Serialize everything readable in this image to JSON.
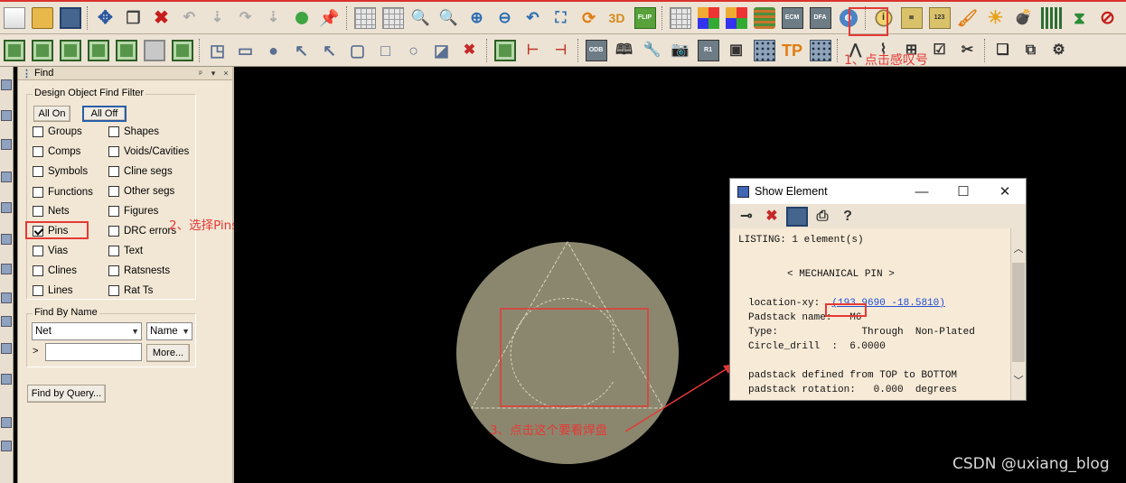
{
  "toolbar_top": {
    "icons": [
      {
        "name": "new-file-icon",
        "kind": "file",
        "text": ""
      },
      {
        "name": "open-folder-icon",
        "kind": "open",
        "text": ""
      },
      {
        "name": "save-icon",
        "kind": "save",
        "text": ""
      },
      {
        "sep": true
      },
      {
        "name": "move-icon",
        "kind": "move",
        "text": "✥"
      },
      {
        "name": "copy-icon",
        "kind": "copy",
        "text": "❐"
      },
      {
        "name": "delete-icon",
        "kind": "del",
        "text": "✖"
      },
      {
        "name": "undo-icon",
        "kind": "gray",
        "text": "↶"
      },
      {
        "name": "step-down-icon",
        "kind": "gray",
        "text": "⇣"
      },
      {
        "name": "redo-icon",
        "kind": "gray",
        "text": "↷"
      },
      {
        "name": "step-down-2-icon",
        "kind": "gray",
        "text": "⇣"
      },
      {
        "name": "shape-edit-icon",
        "kind": "green",
        "text": ""
      },
      {
        "name": "pin-icon",
        "kind": "pin",
        "text": "📌"
      },
      {
        "sep": true
      },
      {
        "name": "grid-toggle-icon",
        "kind": "grid",
        "text": ""
      },
      {
        "name": "grid-points-icon",
        "kind": "grid",
        "text": ""
      },
      {
        "name": "zoom-fit-icon",
        "kind": "zoom",
        "text": "🔍"
      },
      {
        "name": "zoom-point-icon",
        "kind": "zoom",
        "text": "🔍"
      },
      {
        "name": "zoom-in-icon",
        "kind": "zoom",
        "text": "⊕"
      },
      {
        "name": "zoom-out-icon",
        "kind": "zoom",
        "text": "⊖"
      },
      {
        "name": "zoom-previous-icon",
        "kind": "zoom",
        "text": "↶"
      },
      {
        "name": "zoom-world-icon",
        "kind": "zoom",
        "text": "⛶"
      },
      {
        "name": "redraw-icon",
        "kind": "orange",
        "text": "⟳"
      },
      {
        "name": "3d-view-icon",
        "kind": "3d",
        "text": "3D"
      },
      {
        "name": "flip-icon",
        "kind": "flip",
        "text": "FLIP"
      },
      {
        "sep": true
      },
      {
        "name": "grid-setup-icon",
        "kind": "grid",
        "text": ""
      },
      {
        "name": "color-icon",
        "kind": "color",
        "text": ""
      },
      {
        "name": "layer-visibility-icon",
        "kind": "color",
        "text": ""
      },
      {
        "name": "layer-stack-icon",
        "kind": "stack",
        "text": ""
      },
      {
        "name": "ecm-icon",
        "kind": "chip",
        "text": "ECM"
      },
      {
        "name": "dfa-icon",
        "kind": "chip",
        "text": "DFA"
      },
      {
        "name": "globe-icon",
        "kind": "globe",
        "text": "◍"
      },
      {
        "sep": true
      },
      {
        "name": "show-element-info-icon",
        "kind": "info",
        "text": "i"
      },
      {
        "name": "show-measure-icon",
        "kind": "ruler",
        "text": "≣"
      },
      {
        "name": "measure-icon",
        "kind": "ruler",
        "text": "123"
      },
      {
        "name": "brush-icon",
        "kind": "orange",
        "text": "🖌"
      },
      {
        "name": "highlight-icon",
        "kind": "sun",
        "text": "☀"
      },
      {
        "name": "bomb-icon",
        "kind": "tool",
        "text": "💣"
      },
      {
        "name": "bar-chart-icon",
        "kind": "bars",
        "text": ""
      },
      {
        "name": "hourglass-icon",
        "kind": "hour",
        "text": "⧗"
      },
      {
        "name": "no-entry-icon",
        "kind": "del",
        "text": "⊘"
      }
    ]
  },
  "toolbar_second": {
    "icons": [
      {
        "name": "cmd-1-icon",
        "kind": "box",
        "text": ""
      },
      {
        "name": "cmd-2-icon",
        "kind": "box",
        "text": ""
      },
      {
        "name": "cmd-3-icon",
        "kind": "box",
        "text": ""
      },
      {
        "name": "cmd-4-icon",
        "kind": "box",
        "text": ""
      },
      {
        "name": "cmd-5-icon",
        "kind": "box",
        "text": ""
      },
      {
        "name": "cmd-6-icon",
        "kind": "boxg",
        "text": ""
      },
      {
        "name": "cmd-7-icon",
        "kind": "box",
        "text": ""
      },
      {
        "sep": true
      },
      {
        "name": "add-corner-icon",
        "kind": "shape",
        "text": "◳"
      },
      {
        "name": "add-rect-icon",
        "kind": "shape",
        "text": "▭"
      },
      {
        "name": "add-circle-icon",
        "kind": "shape",
        "text": "●"
      },
      {
        "name": "select-icon",
        "kind": "shape",
        "text": "↖"
      },
      {
        "name": "select-2-icon",
        "kind": "shape",
        "text": "↖"
      },
      {
        "name": "rounded-rect-icon",
        "kind": "shape",
        "text": "▢"
      },
      {
        "name": "square-icon",
        "kind": "shape",
        "text": "□"
      },
      {
        "name": "circle-outline-icon",
        "kind": "shape",
        "text": "○"
      },
      {
        "name": "shape-3-icon",
        "kind": "shape",
        "text": "◪"
      },
      {
        "name": "delete-shape-icon",
        "kind": "x",
        "text": "✖"
      },
      {
        "sep": true
      },
      {
        "name": "component-icon",
        "kind": "box",
        "text": ""
      },
      {
        "name": "dimension-icon",
        "kind": "dim",
        "text": "⊢"
      },
      {
        "name": "dimension-2-icon",
        "kind": "dim",
        "text": "⊣"
      },
      {
        "sep": true
      },
      {
        "name": "odb-icon",
        "kind": "chip",
        "text": "ODB"
      },
      {
        "name": "book-icon",
        "kind": "tool",
        "text": "🕮"
      },
      {
        "name": "wrench-icon",
        "kind": "tool",
        "text": "🔧"
      },
      {
        "name": "camera-icon",
        "kind": "tool",
        "text": "📷"
      },
      {
        "name": "refdes-icon",
        "kind": "chip",
        "text": "R1"
      },
      {
        "name": "drill-icon",
        "kind": "tool",
        "text": "▣"
      },
      {
        "name": "matrix-icon",
        "kind": "mat",
        "text": ""
      },
      {
        "name": "testpoint-icon",
        "kind": "orange",
        "text": "TP"
      },
      {
        "name": "via-array-icon",
        "kind": "mat",
        "text": ""
      },
      {
        "sep": true
      },
      {
        "name": "route-icon",
        "kind": "tool",
        "text": "⋀"
      },
      {
        "name": "slide-icon",
        "kind": "tool",
        "text": "⌇"
      },
      {
        "name": "spread-icon",
        "kind": "tool",
        "text": "⊞"
      },
      {
        "name": "check-icon",
        "kind": "tool",
        "text": "☑"
      },
      {
        "name": "cut-icon",
        "kind": "tool",
        "text": "✂"
      },
      {
        "sep": true
      },
      {
        "name": "window-icon",
        "kind": "tool",
        "text": "❏"
      },
      {
        "name": "arrange-icon",
        "kind": "tool",
        "text": "⧉"
      },
      {
        "name": "tool-end-icon",
        "kind": "tool",
        "text": "⚙"
      }
    ]
  },
  "annotations": {
    "step1": "1、点击感叹号",
    "step2": "2、选择Pins",
    "step3": "3、点击这个要看焊盘"
  },
  "find_panel": {
    "title": "Find",
    "pin_button": "ᵖ",
    "menu_button": "▾",
    "close_button": "×",
    "filter_group_label": "Design Object Find Filter",
    "all_on_label": "All On",
    "all_off_label": "All Off",
    "checkboxes": {
      "groups": {
        "label": "Groups",
        "checked": false
      },
      "shapes": {
        "label": "Shapes",
        "checked": false
      },
      "comps": {
        "label": "Comps",
        "checked": false
      },
      "voids": {
        "label": "Voids/Cavities",
        "checked": false
      },
      "symbols": {
        "label": "Symbols",
        "checked": false
      },
      "cline_segs": {
        "label": "Cline segs",
        "checked": false
      },
      "functions": {
        "label": "Functions",
        "checked": false
      },
      "other_segs": {
        "label": "Other segs",
        "checked": false
      },
      "nets": {
        "label": "Nets",
        "checked": false
      },
      "figures": {
        "label": "Figures",
        "checked": false
      },
      "pins": {
        "label": "Pins",
        "checked": true
      },
      "drc_errors": {
        "label": "DRC errors",
        "checked": false
      },
      "vias": {
        "label": "Vias",
        "checked": false
      },
      "text": {
        "label": "Text",
        "checked": false
      },
      "clines": {
        "label": "Clines",
        "checked": false
      },
      "ratsnests": {
        "label": "Ratsnests",
        "checked": false
      },
      "lines": {
        "label": "Lines",
        "checked": false
      },
      "rat_ts": {
        "label": "Rat Ts",
        "checked": false
      }
    },
    "find_by_name_label": "Find By Name",
    "type_select_value": "Net",
    "mode_select_value": "Name",
    "name_prefix": ">",
    "name_input_value": "",
    "more_button": "More...",
    "find_by_query_button": "Find by Query..."
  },
  "show_element": {
    "title": "Show Element",
    "minimize": "—",
    "maximize": "☐",
    "close": "✕",
    "listing": "LISTING: 1 element(s)",
    "header": "< MECHANICAL PIN >",
    "location_label": "location-xy:",
    "location_value": "(193.9690 -18.5810)",
    "padstack_label": "Padstack name:",
    "padstack_value": "M6",
    "type_label": "Type:",
    "type_value": "Through  Non-Plated",
    "drill_label": "Circle_drill  :",
    "drill_value": "6.0000",
    "defined_line": "padstack defined from TOP to BOTTOM",
    "rotation_line": "padstack rotation:   0.000  degrees"
  },
  "watermark": "CSDN @uxiang_blog",
  "colors": {
    "accent_red": "#e53935",
    "canvas": "#000000",
    "pad_fill": "#8b876f",
    "outline": "#d8d4b8"
  }
}
